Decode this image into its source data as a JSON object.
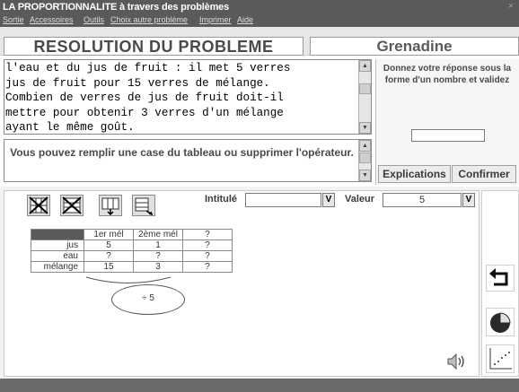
{
  "window": {
    "title": "LA PROPORTIONNALITE à travers des problèmes",
    "close_glyph": "×"
  },
  "menu": [
    {
      "label": "Sortie"
    },
    {
      "label": "Accessoires"
    },
    {
      "label": "Outils"
    },
    {
      "label": "Choix autre problème"
    },
    {
      "label": "Imprimer"
    },
    {
      "label": "Aide"
    }
  ],
  "header": {
    "title": "RESOLUTION DU PROBLEME",
    "subject": "Grenadine"
  },
  "problem": {
    "text": "l'eau et du jus de fruit : il met 5 verres\njus de fruit pour 15 verres de mélange.\nCombien de verres de jus de fruit doit-il\nmettre pour obtenir 3 verres d'un mélange\nayant le même goût."
  },
  "instructions": {
    "text": "Vous pouvez remplir une case du tableau ou supprimer l'opérateur."
  },
  "answer_panel": {
    "prompt": "Donnez votre réponse sous la forme d'un nombre et validez",
    "input_value": "",
    "explications_label": "Explications",
    "confirmer_label": "Confirmer"
  },
  "toolbar": {
    "intitule_label": "Intitulé",
    "intitule_value": "",
    "valeur_label": "Valeur",
    "valeur_value": "5",
    "dropdown_glyph": "V"
  },
  "table": {
    "headers": [
      "",
      "1er mél",
      "2ème mél",
      "?"
    ],
    "rows": [
      {
        "label": "jus",
        "cells": [
          "5",
          "1",
          "?"
        ]
      },
      {
        "label": "eau",
        "cells": [
          "?",
          "?",
          "?"
        ]
      },
      {
        "label": "mélange",
        "cells": [
          "15",
          "3",
          "?"
        ]
      }
    ]
  },
  "operator": {
    "text": "÷ 5"
  },
  "icons": {
    "tool_buttons": [
      "delete-column-icon",
      "delete-row-icon",
      "add-column-icon",
      "add-row-icon"
    ],
    "side": [
      "undo-arrow-icon",
      "pie-chart-icon",
      "scatter-plot-icon"
    ],
    "speaker": "speaker-icon"
  }
}
